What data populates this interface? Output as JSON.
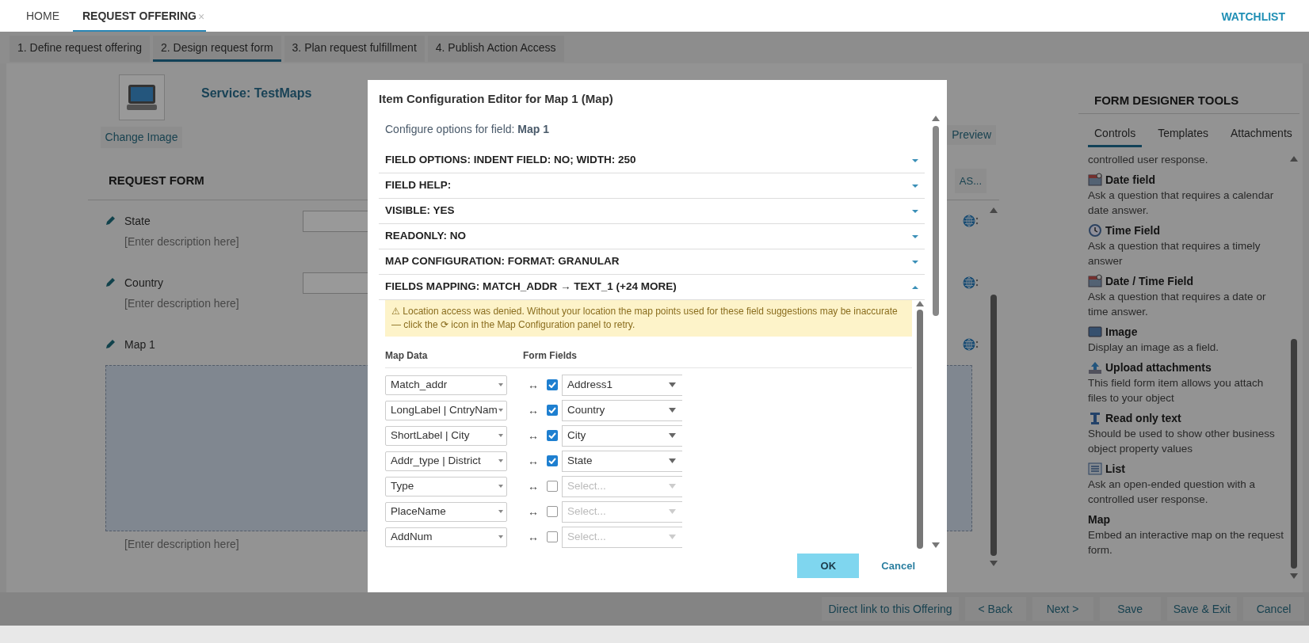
{
  "top_tabs": [
    {
      "label": "HOME",
      "selected": false
    },
    {
      "label": "REQUEST OFFERING",
      "selected": true,
      "close": "×"
    }
  ],
  "watchlist": "WATCHLIST",
  "steps": [
    {
      "label": "1. Define request offering",
      "selected": false
    },
    {
      "label": "2. Design request form",
      "selected": true
    },
    {
      "label": "3. Plan request fulfillment",
      "selected": false
    },
    {
      "label": "4. Publish Action Access",
      "selected": false
    }
  ],
  "service": {
    "title": "Service: TestMaps",
    "change_image": "Change Image",
    "preview": "Preview",
    "cut_button": "AS..."
  },
  "request_form": {
    "heading": "REQUEST FORM",
    "fields": [
      {
        "kind": "text",
        "label": "State",
        "description": "[Enter description here]"
      },
      {
        "kind": "text",
        "label": "Country",
        "description": "[Enter description here]"
      },
      {
        "kind": "map",
        "label": "Map 1",
        "description": "[Enter description here]"
      }
    ]
  },
  "tools": {
    "title": "FORM DESIGNER TOOLS",
    "tabs": [
      {
        "label": "Controls",
        "selected": true
      },
      {
        "label": "Templates",
        "selected": false
      },
      {
        "label": "Attachments",
        "selected": false
      }
    ],
    "items": [
      {
        "description": "controlled user response."
      },
      {
        "kind": "date",
        "title": "Date field",
        "description": "Ask a question that requires a calendar date answer."
      },
      {
        "kind": "time",
        "title": "Time Field",
        "description": "Ask a question that requires a timely answer"
      },
      {
        "kind": "date",
        "title": "Date / Time Field",
        "description": "Ask a question that requires a date or time answer."
      },
      {
        "kind": "image",
        "title": "Image",
        "description": "Display an image as a field."
      },
      {
        "kind": "upload",
        "title": "Upload attachments",
        "description": "This field form item allows you attach files to your object"
      },
      {
        "kind": "readonly",
        "title": "Read only text",
        "description": "Should be used to show other business object property values"
      },
      {
        "kind": "list",
        "title": "List",
        "description": "Ask an open-ended question with a controlled user response."
      },
      {
        "kind": "plain",
        "title": "Map",
        "description": "Embed an interactive map on the request form."
      }
    ]
  },
  "footer_buttons": [
    "Direct link to this Offering",
    "< Back",
    "Next >",
    "Save",
    "Save & Exit",
    "Cancel"
  ],
  "modal": {
    "title": "Item Configuration Editor for Map 1 (Map)",
    "intro": "Configure options for field: **Map 1**",
    "sections": [
      {
        "label": "FIELD OPTIONS: INDENT FIELD: NO; WIDTH: 250",
        "expanded": false
      },
      {
        "label": "FIELD HELP:",
        "expanded": false
      },
      {
        "label": "VISIBLE: YES",
        "expanded": false
      },
      {
        "label": "READONLY: NO",
        "expanded": false
      },
      {
        "label": "MAP CONFIGURATION: FORMAT: GRANULAR",
        "expanded": false
      },
      {
        "label": "FIELDS MAPPING: MATCH_ADDR → TEXT_1 (+24 MORE)",
        "expanded": true
      }
    ],
    "warning": "⚠ Location access was denied. Without your location the map points used for these field suggestions may be inaccurate — click the ⟳ icon in the Map Configuration panel to retry.",
    "columns": [
      "Map Data",
      "Form Fields"
    ],
    "mappings": [
      {
        "source": "Match_addr",
        "link": "↔",
        "checked": true,
        "target": "Address1"
      },
      {
        "source": "LongLabel | CntryNam",
        "link": "↔",
        "checked": true,
        "target": "Country"
      },
      {
        "source": "ShortLabel | City",
        "link": "↔",
        "checked": true,
        "target": "City"
      },
      {
        "source": "Addr_type | District",
        "link": "↔",
        "checked": true,
        "target": "State"
      },
      {
        "source": "Type",
        "link": "↔",
        "checked": false,
        "placeholder": "Select..."
      },
      {
        "source": "PlaceName",
        "link": "↔",
        "checked": false,
        "placeholder": "Select..."
      },
      {
        "source": "AddNum",
        "link": "↔",
        "checked": false,
        "placeholder": "Select..."
      }
    ],
    "ok": "OK",
    "cancel": "Cancel"
  }
}
